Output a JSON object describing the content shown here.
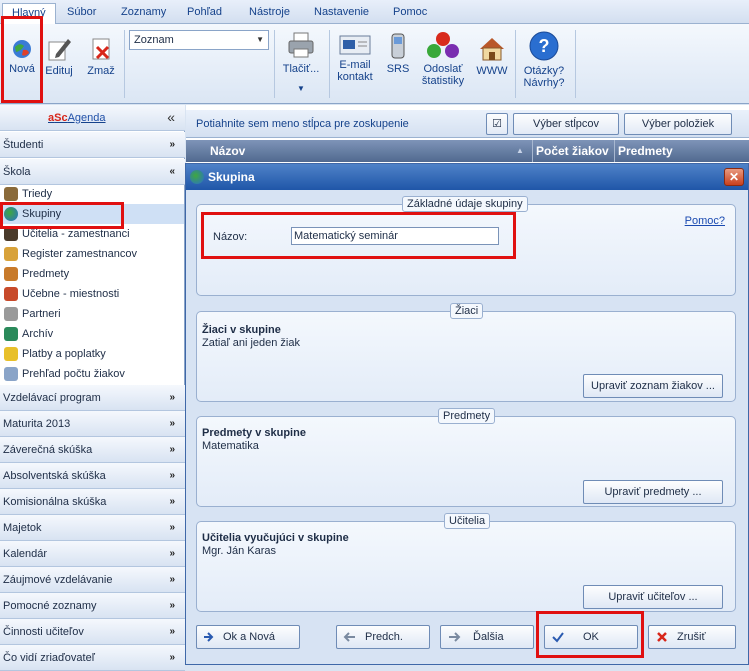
{
  "menu": [
    "Hlavný",
    "Súbor",
    "Zoznamy",
    "Pohľad",
    "Nástroje",
    "Nastavenie",
    "Pomoc"
  ],
  "ribbon": {
    "nova": "Nová",
    "edituj": "Edituj",
    "zmaz": "Zmaž",
    "view_select": "Zoznam",
    "tlacit": "Tlačiť...",
    "email": "E-mail kontakt",
    "srs": "SRS",
    "odoslat": "Odoslať štatistiky",
    "www": "WWW",
    "otazky": "Otázky? Návrhy?"
  },
  "sidebar": {
    "logo_a": "a",
    "logo_sc": "Sc",
    "logo_agenda": "Agenda",
    "collapse": "«",
    "studenti": "Študenti",
    "skola": "Škola",
    "items": [
      "Triedy",
      "Skupiny",
      "Učitelia - zamestnanci",
      "Register zamestnancov",
      "Predmety",
      "Učebne - miestnosti",
      "Partneri",
      "Archív",
      "Platby a poplatky",
      "Prehľad počtu žiakov"
    ],
    "sections": [
      "Vzdelávací program",
      "Maturita 2013",
      "Záverečná skúška",
      "Absolventská skúška",
      "Komisionálna skúška",
      "Majetok",
      "Kalendár",
      "Záujmové vzdelávanie",
      "Pomocné zoznamy",
      "Činnosti učiteľov",
      "Čo vidí zriaďovateľ"
    ]
  },
  "grid": {
    "group_hint": "Potiahnite sem meno stĺpca pre zoskupenie",
    "check_glyph": "☑",
    "vyber_stlpcov": "Výber stĺpcov",
    "vyber_poloziek": "Výber položiek",
    "columns": [
      "Názov",
      "Počet žiakov",
      "Predmety"
    ]
  },
  "dialog": {
    "title": "Skupina",
    "close": "✕",
    "basic": {
      "caption": "Základné údaje skupiny",
      "help": "Pomoc?",
      "name_label": "Názov:",
      "name_value": "Matematický seminár"
    },
    "ziaci": {
      "caption": "Žiaci",
      "heading": "Žiaci v skupine",
      "text": "Zatiaľ ani jeden žiak",
      "button": "Upraviť zoznam žiakov ..."
    },
    "predmety": {
      "caption": "Predmety",
      "heading": "Predmety v skupine",
      "text": "Matematika",
      "button": "Upraviť predmety ..."
    },
    "ucitelia": {
      "caption": "Učitelia",
      "heading": "Učitelia vyučujúci v skupine",
      "text": "Mgr. Ján Karas",
      "button": "Upraviť učiteľov ..."
    },
    "footer": {
      "ok_nova": "Ok a Nová",
      "predch": "Predch.",
      "dalsia": "Ďalšia",
      "ok": "OK",
      "zrusit": "Zrušiť"
    }
  }
}
